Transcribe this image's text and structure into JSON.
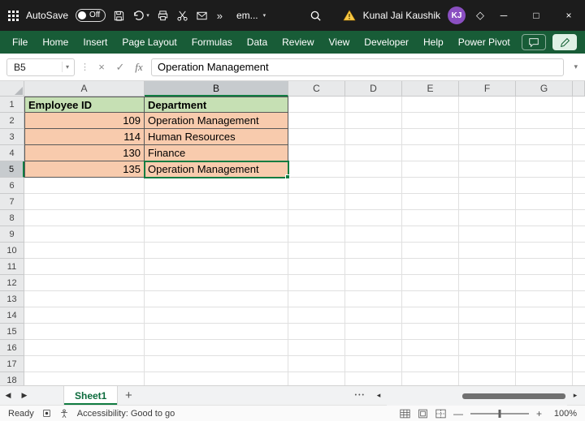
{
  "titlebar": {
    "autosave_label": "AutoSave",
    "autosave_state": "Off",
    "more_chevron": "»",
    "doc_name": "em...",
    "user_name": "Kunal Jai Kaushik",
    "user_initials": "KJ"
  },
  "ribbon_tabs": [
    "File",
    "Home",
    "Insert",
    "Page Layout",
    "Formulas",
    "Data",
    "Review",
    "View",
    "Developer",
    "Help",
    "Power Pivot"
  ],
  "formula_bar": {
    "name_box": "B5",
    "fx": "fx",
    "value": "Operation Management"
  },
  "grid": {
    "columns": [
      "A",
      "B",
      "C",
      "D",
      "E",
      "F",
      "G"
    ],
    "visible_rows": 18,
    "selected": {
      "cell": "B5",
      "column": "B",
      "row": 5
    },
    "data": {
      "1": {
        "A": "Employee ID",
        "B": "Department"
      },
      "2": {
        "A": "109",
        "B": "Operation Management"
      },
      "3": {
        "A": "114",
        "B": "Human Resources"
      },
      "4": {
        "A": "130",
        "B": "Finance"
      },
      "5": {
        "A": "135",
        "B": "Operation Management"
      }
    }
  },
  "sheet_bar": {
    "tabs": [
      {
        "label": "Sheet1",
        "active": true
      }
    ]
  },
  "status_bar": {
    "mode": "Ready",
    "accessibility": "Accessibility: Good to go",
    "zoom_out": "—",
    "zoom_in": "+",
    "zoom_level": "100%"
  },
  "icons": {
    "chevron_down": "▾",
    "minimize": "─",
    "maximize": "□",
    "close": "×",
    "diamond": "◇",
    "vertical_dots": "⋮",
    "cancel": "×",
    "enter": "✓",
    "nav_left": "◀",
    "nav_right": "▶",
    "scroll_left": "◂",
    "scroll_right": "▸",
    "tab_options": "•••",
    "add_sheet": "+"
  },
  "colors": {
    "title_bg": "#1c1c1c",
    "ribbon_green": "#185C37",
    "accent_green": "#107C41",
    "header_fill": "#C6E0B4",
    "data_fill": "#F8CBAD",
    "avatar": "#8A4FC1",
    "warning_yellow": "#F7C948"
  }
}
